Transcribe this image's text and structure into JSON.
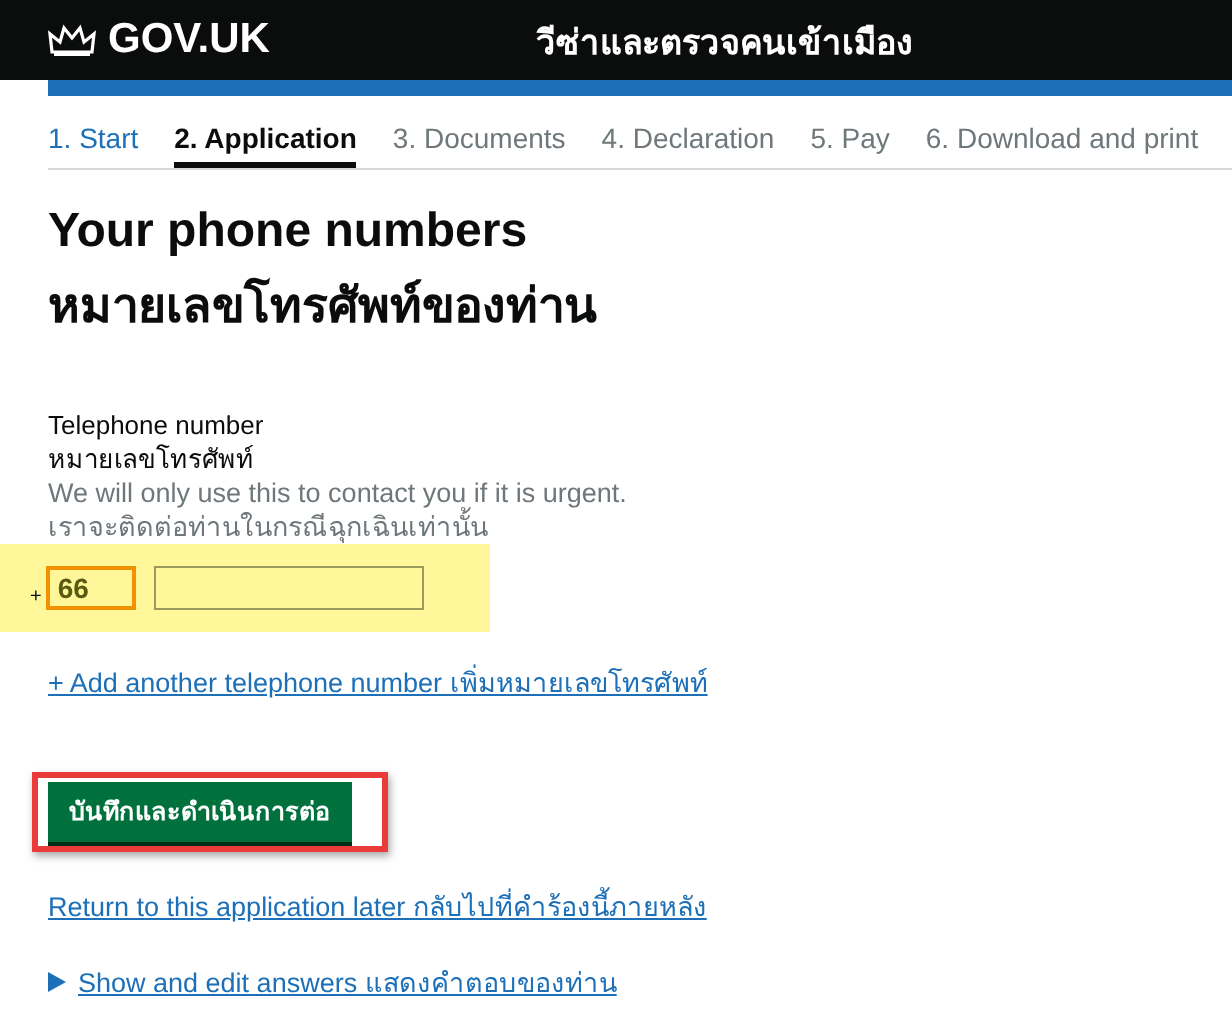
{
  "header": {
    "logo": "GOV.UK",
    "service": "วีซ่าและตรวจคนเข้าเมือง"
  },
  "steps": [
    {
      "label": "1. Start",
      "selected": false
    },
    {
      "label": "2. Application",
      "selected": true
    },
    {
      "label": "3. Documents",
      "selected": false
    },
    {
      "label": "4. Declaration",
      "selected": false
    },
    {
      "label": "5. Pay",
      "selected": false
    },
    {
      "label": "6. Download and print",
      "selected": false
    }
  ],
  "heading": "Your phone numbers",
  "heading_thai": "หมายเลขโทรศัพท์ของท่าน",
  "field": {
    "label": "Telephone number",
    "label_thai": "หมายเลขโทรศัพท์",
    "hint": "We will only use this to contact you if it is urgent.",
    "hint_thai": "เราจะติดต่อท่านในกรณีฉุกเฉินเท่านั้น",
    "prefix": "+",
    "code": {
      "value": "66",
      "focused": true
    },
    "number": {
      "focused": false
    }
  },
  "add_link": "+ Add another telephone number เพิ่มหมายเลขโทรศัพท์",
  "submit_button": "บันทึกและดำเนินการต่อ",
  "return_link": "Return to this application later กลับไปที่คำร้องนี้ภายหลัง",
  "details": {
    "label": "Show and edit answers แสดงคำตอบของท่าน",
    "expanded": false
  }
}
